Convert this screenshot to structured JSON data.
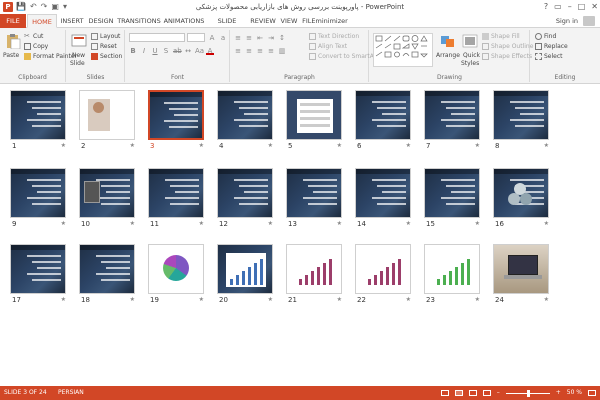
{
  "window": {
    "title": "پاورپوینت بررسی روش های بازاریابی محصولات پزشکی - PowerPoint",
    "app_icon": "P",
    "controls": [
      "?",
      "▭",
      "–",
      "□",
      "✕"
    ]
  },
  "qat": [
    "💾",
    "↶",
    "↷",
    "▣",
    "▾"
  ],
  "tabs": [
    {
      "label": "FILE"
    },
    {
      "label": "HOME"
    },
    {
      "label": "INSERT"
    },
    {
      "label": "DESIGN"
    },
    {
      "label": "TRANSITIONS"
    },
    {
      "label": "ANIMATIONS"
    },
    {
      "label": "SLIDE SHOW"
    },
    {
      "label": "REVIEW"
    },
    {
      "label": "VIEW"
    },
    {
      "label": "FILEminimizer"
    }
  ],
  "account": {
    "signin": "Sign in"
  },
  "ribbon": {
    "clipboard": {
      "label": "Clipboard",
      "paste": "Paste",
      "cut": "Cut",
      "copy": "Copy",
      "format_painter": "Format Painter"
    },
    "slides": {
      "label": "Slides",
      "new_slide": "New",
      "new_slide2": "Slide",
      "layout": "Layout",
      "reset": "Reset",
      "section": "Section"
    },
    "font": {
      "label": "Font"
    },
    "paragraph": {
      "label": "Paragraph",
      "text_direction": "Text Direction",
      "align_text": "Align Text",
      "convert_smartart": "Convert to SmartArt"
    },
    "drawing": {
      "label": "Drawing",
      "arrange": "Arrange",
      "quick_styles": "Quick",
      "quick_styles2": "Styles",
      "shape_fill": "Shape Fill",
      "shape_outline": "Shape Outline",
      "shape_effects": "Shape Effects"
    },
    "editing": {
      "label": "Editing",
      "find": "Find",
      "replace": "Replace",
      "select": "Select"
    }
  },
  "slides": [
    {
      "number": "1",
      "star": "★"
    },
    {
      "number": "2",
      "star": "★"
    },
    {
      "number": "3",
      "star": "★"
    },
    {
      "number": "4",
      "star": "★"
    },
    {
      "number": "5",
      "star": "★"
    },
    {
      "number": "6",
      "star": "★"
    },
    {
      "number": "7",
      "star": "★"
    },
    {
      "number": "8",
      "star": "★"
    },
    {
      "number": "9",
      "star": "★"
    },
    {
      "number": "10",
      "star": "★"
    },
    {
      "number": "11",
      "star": "★"
    },
    {
      "number": "12",
      "star": "★"
    },
    {
      "number": "13",
      "star": "★"
    },
    {
      "number": "14",
      "star": "★"
    },
    {
      "number": "15",
      "star": "★"
    },
    {
      "number": "16",
      "star": "★"
    },
    {
      "number": "17",
      "star": "★"
    },
    {
      "number": "18",
      "star": "★"
    },
    {
      "number": "19",
      "star": "★"
    },
    {
      "number": "20",
      "star": "★"
    },
    {
      "number": "21",
      "star": "★"
    },
    {
      "number": "22",
      "star": "★"
    },
    {
      "number": "23",
      "star": "★"
    },
    {
      "number": "24",
      "star": "★"
    }
  ],
  "selected_slide": "3",
  "status": {
    "slide_info": "SLIDE 3 OF 24",
    "language": "PERSIAN",
    "zoom": "50 %",
    "zoom_minus": "–",
    "zoom_plus": "+"
  },
  "colors": {
    "accent": "#d24726",
    "ribbon_bg": "#f3f3f3"
  }
}
